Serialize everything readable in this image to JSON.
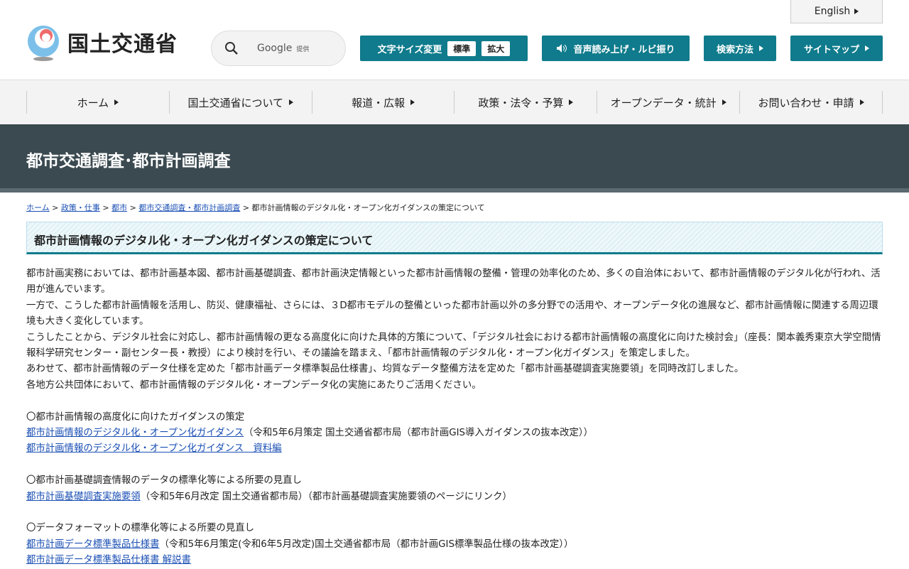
{
  "header": {
    "english": "English",
    "logo_text": "国土交通省",
    "search_brand": "Google",
    "search_provided": "提供",
    "font_size_label": "文字サイズ変更",
    "font_standard": "標準",
    "font_large": "拡大",
    "speech": "音声読み上げ・ルビ振り",
    "search_method": "検索方法",
    "sitemap": "サイトマップ"
  },
  "nav": [
    "ホーム",
    "国土交通省について",
    "報道・広報",
    "政策・法令・予算",
    "オープンデータ・統計",
    "お問い合わせ・申請"
  ],
  "banner": "都市交通調査･都市計画調査",
  "breadcrumb": {
    "items": [
      "ホーム",
      "政策・仕事",
      "都市",
      "都市交通調査・都市計画調査"
    ],
    "sep": ">",
    "current": "都市計画情報のデジタル化・オープン化ガイダンスの策定について"
  },
  "title": "都市計画情報のデジタル化・オープン化ガイダンスの策定について",
  "paragraphs": [
    "都市計画実務においては、都市計画基本図、都市計画基礎調査、都市計画決定情報といった都市計画情報の整備・管理の効率化のため、多くの自治体において、都市計画情報のデジタル化が行われ、活用が進んでいます。",
    "一方で、こうした都市計画情報を活用し、防災、健康福祉、さらには、３D都市モデルの整備といった都市計画以外の多分野での活用や、オープンデータ化の進展など、都市計画情報に関連する周辺環境も大きく変化しています。",
    "こうしたことから、デジタル社会に対応し、都市計画情報の更なる高度化に向けた具体的方策について、「デジタル社会における都市計画情報の高度化に向けた検討会」（座長：関本義秀東京大学空間情報科学研究センター・副センター長・教授）により検討を行い、その議論を踏まえ、「都市計画情報のデジタル化・オープン化ガイダンス」を策定しました。",
    "あわせて、都市計画情報のデータ仕様を定めた「都市計画データ標準製品仕様書」、均質なデータ整備方法を定めた「都市計画基礎調査実施要領」を同時改訂しました。",
    "各地方公共団体において、都市計画情報のデジタル化・オープンデータ化の実施にあたりご活用ください。"
  ],
  "sections": [
    {
      "heading": "〇都市計画情報の高度化に向けたガイダンスの策定",
      "link1": "都市計画情報のデジタル化・オープン化ガイダンス",
      "note1": "（令和5年6月策定 国土交通省都市局（都市計画GIS導入ガイダンスの抜本改定））",
      "link2": "都市計画情報のデジタル化・オープン化ガイダンス　資料編"
    },
    {
      "heading": "〇都市計画基礎調査情報のデータの標準化等による所要の見直し",
      "link1": "都市計画基礎調査実施要領",
      "note1": "（令和5年6月改定 国土交通省都市局）（都市計画基礎調査実施要領のページにリンク）"
    },
    {
      "heading": "〇データフォーマットの標準化等による所要の見直し",
      "link1": "都市計画データ標準製品仕様書",
      "note1": "（令和5年6月策定(令和6年5月改定)国土交通省都市局（都市計画GIS標準製品仕様の抜本改定））",
      "link2": "都市計画データ標準製品仕様書 解説書"
    }
  ]
}
